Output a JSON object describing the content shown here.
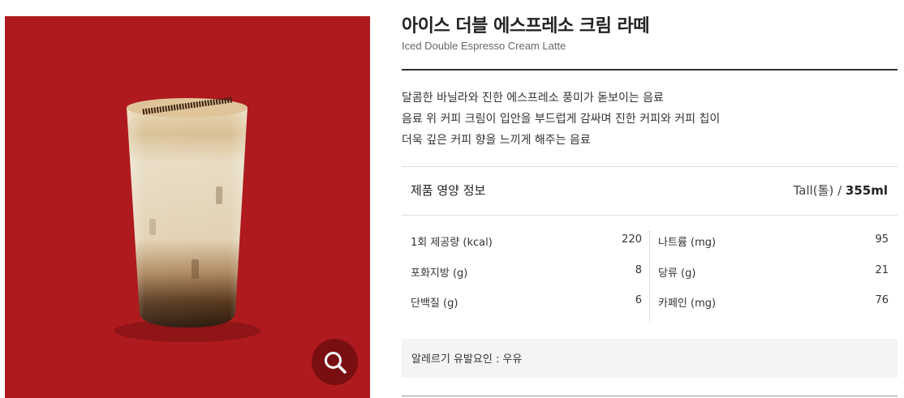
{
  "product": {
    "name_ko": "아이스 더블 에스프레소 크림 라떼",
    "name_en": "Iced Double Espresso Cream Latte",
    "description": [
      "달콤한 바닐라와 진한 에스프레소 풍미가 돋보이는 음료",
      "음료 위 커피 크림이 입안을 부드럽게 감싸며 진한 커피와 커피 칩이",
      "더욱 깊은 커피 향을 느끼게 해주는 음료"
    ],
    "image": {
      "background": "#ae1a1d",
      "zoom_icon": "magnifier-icon"
    }
  },
  "nutrition": {
    "title": "제품 영양 정보",
    "size_label": "Tall(톨) / ",
    "size_volume": "355ml",
    "left": [
      {
        "label": "1회 제공량 (kcal)",
        "value": "220"
      },
      {
        "label": "포화지방 (g)",
        "value": "8"
      },
      {
        "label": "단백질 (g)",
        "value": "6"
      }
    ],
    "right": [
      {
        "label": "나트륨 (mg)",
        "value": "95"
      },
      {
        "label": "당류 (g)",
        "value": "21"
      },
      {
        "label": "카페인 (mg)",
        "value": "76"
      }
    ]
  },
  "allergy": "알레르기 유발요인 : 우유"
}
